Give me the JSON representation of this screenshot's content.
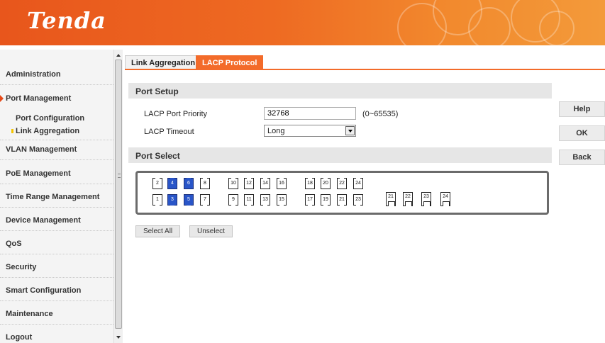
{
  "brand": {
    "logo_text": "Tenda",
    "accent": "#f36b2a"
  },
  "sidebar": {
    "items": [
      {
        "label": "Administration"
      },
      {
        "label": "Port Management",
        "expanded": true
      },
      {
        "label": "Port Configuration",
        "sub": true
      },
      {
        "label": "Link Aggregation",
        "sub": true,
        "active": true
      },
      {
        "label": "VLAN Management"
      },
      {
        "label": "PoE Management"
      },
      {
        "label": "Time Range Management"
      },
      {
        "label": "Device Management"
      },
      {
        "label": "QoS"
      },
      {
        "label": "Security"
      },
      {
        "label": "Smart Configuration"
      },
      {
        "label": "Maintenance"
      },
      {
        "label": "Logout"
      }
    ]
  },
  "tabs": [
    {
      "label": "Link Aggregation",
      "active": false
    },
    {
      "label": "LACP Protocol",
      "active": true
    }
  ],
  "port_setup": {
    "title": "Port Setup",
    "priority_label": "LACP Port Priority",
    "priority_value": "32768",
    "priority_range": "(0~65535)",
    "timeout_label": "LACP Timeout",
    "timeout_value": "Long"
  },
  "port_select": {
    "title": "Port Select",
    "top_row": [
      "2",
      "4",
      "6",
      "8",
      "10",
      "12",
      "14",
      "16",
      "18",
      "20",
      "22",
      "24"
    ],
    "bottom_row": [
      "1",
      "3",
      "5",
      "7",
      "9",
      "11",
      "13",
      "15",
      "17",
      "19",
      "21",
      "23"
    ],
    "sfp_ports": [
      "21",
      "22",
      "23",
      "24"
    ],
    "selected": [
      "3",
      "4",
      "5",
      "6"
    ]
  },
  "buttons": {
    "select_all": "Select All",
    "unselect": "Unselect",
    "help": "Help",
    "ok": "OK",
    "back": "Back"
  }
}
